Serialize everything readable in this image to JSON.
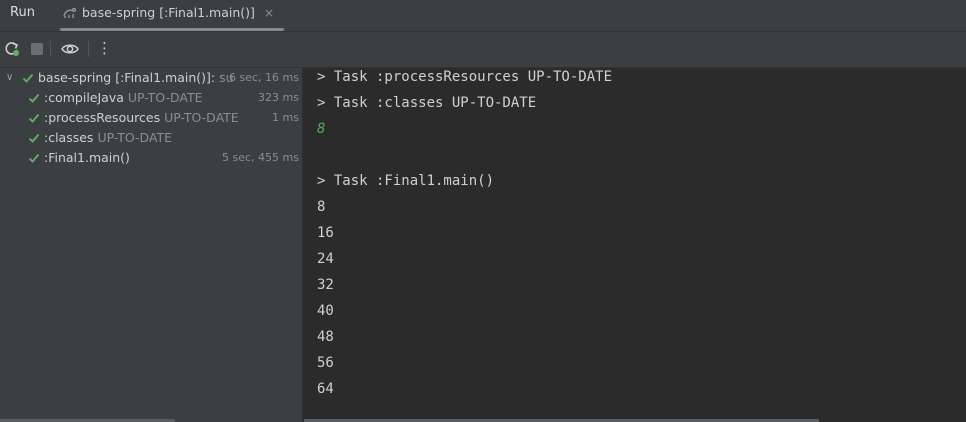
{
  "tabs": {
    "run_label": "Run",
    "main_label": "base-spring [:Final1.main()]",
    "close_glyph": "×"
  },
  "toolbar": {
    "rerun_icon": "rerun-icon",
    "stop_icon": "stop-icon",
    "view_icon": "eye-icon",
    "more_glyph": "⋮"
  },
  "tree": {
    "root": {
      "label": "base-spring [:Final1.main()]:",
      "suffix": "su",
      "time": "6 sec, 16 ms"
    },
    "items": [
      {
        "label": ":compileJava",
        "status": "UP-TO-DATE",
        "time": "323 ms"
      },
      {
        "label": ":processResources",
        "status": "UP-TO-DATE",
        "time": "1 ms"
      },
      {
        "label": ":classes",
        "status": "UP-TO-DATE",
        "time": ""
      },
      {
        "label": ":Final1.main()",
        "status": "",
        "time": "5 sec, 455 ms"
      }
    ]
  },
  "console": {
    "lines": [
      "> Task :processResources UP-TO-DATE",
      "> Task :classes UP-TO-DATE",
      "8",
      "",
      "> Task :Final1.main()",
      "8",
      "16",
      "24",
      "32",
      "40",
      "48",
      "56",
      "64"
    ]
  },
  "colors": {
    "success": "#5fb25f",
    "accent_green": "#54a857"
  }
}
